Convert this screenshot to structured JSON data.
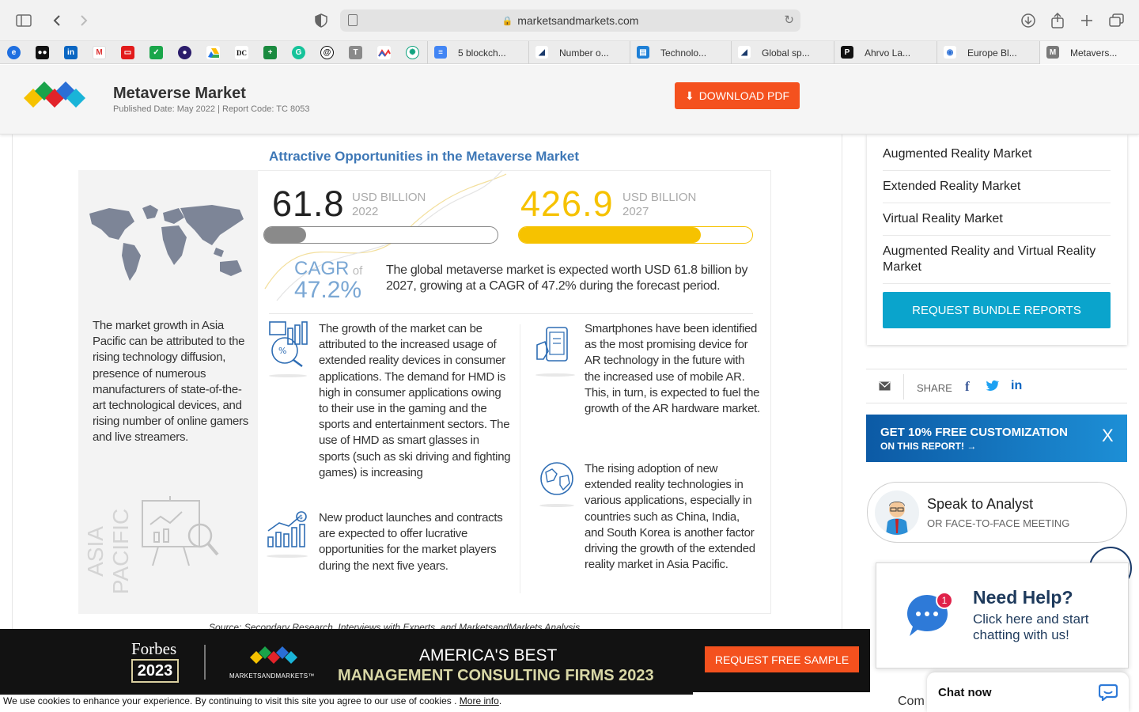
{
  "browser": {
    "url": "marketsandmarkets.com"
  },
  "bookmarks": {
    "tabs": [
      {
        "label": "5 blockch..."
      },
      {
        "label": "Number o..."
      },
      {
        "label": "Technolo..."
      },
      {
        "label": "Global sp..."
      },
      {
        "label": "Ahrvo La..."
      },
      {
        "label": "Europe Bl..."
      },
      {
        "label": "Metavers..."
      }
    ]
  },
  "header": {
    "title": "Metaverse Market",
    "subtitle": "Published Date: May 2022 | Report Code: TC 8053",
    "download_label": "DOWNLOAD PDF"
  },
  "infographic": {
    "title": "Attractive Opportunities in the Metaverse Market",
    "value_2022": "61.8",
    "unit_2022": "USD BILLION",
    "year_2022": "2022",
    "progress_2022": 0.18,
    "value_2027": "426.9",
    "unit_2027": "USD BILLION",
    "year_2027": "2027",
    "progress_2027": 0.78,
    "cagr_label": "CAGR",
    "cagr_of": "of",
    "cagr_value": "47.2%",
    "summary": "The global metaverse market is expected worth USD 61.8 billion by 2027, growing at a CAGR of 47.2% during the forecast period.",
    "asia_text": "The market growth in Asia Pacific can be attributed to the rising technology diffusion, presence of numerous manufacturers of state-of-the-art technological devices, and rising number of online gamers and live streamers.",
    "region_label": "ASIA PACIFIC",
    "point1": "The growth of the market can be attributed to the increased usage of extended reality devices in consumer applications. The demand for HMD is high in consumer applications owing to their use in the gaming and the sports and entertainment sectors. The use of HMD as smart glasses in sports (such as ski driving and fighting games) is increasing",
    "point2": "New product launches and contracts are expected to offer lucrative opportunities for the market players during the next five years.",
    "point3": "Smartphones have been identified as the most promising device for AR technology in the future with the increased use of mobile AR. This, in turn, is expected to fuel the growth of the AR hardware market.",
    "point4": "The rising adoption of new extended reality technologies in various applications, especially in countries such as China, India, and South Korea is another factor driving the growth of the extended reality market in Asia Pacific.",
    "source": "Source: Secondary Research, Interviews with Experts, and MarketsandMarkets Analysis"
  },
  "sidebar": {
    "related": [
      {
        "label": "Augmented Reality Market"
      },
      {
        "label": "Extended Reality Market"
      },
      {
        "label": "Virtual Reality Market"
      },
      {
        "label": "Augmented Reality and Virtual Reality Market"
      }
    ],
    "bundle_label": "REQUEST BUNDLE REPORTS",
    "share_label": "SHARE",
    "custom_title": "GET 10% FREE CUSTOMIZATION",
    "custom_sub": "ON THIS REPORT!",
    "custom_close": "X",
    "analyst_title": "Speak to Analyst",
    "analyst_sub": "OR FACE-TO-FACE MEETING"
  },
  "footer": {
    "forbes": "Forbes",
    "year_badge": "2023",
    "mm_brand": "MARKETSANDMARKETS™",
    "line1": "AMERICA'S BEST",
    "line2": "MANAGEMENT CONSULTING FIRMS 2023",
    "sample_label": "REQUEST FREE SAMPLE",
    "cookie_text": "We use cookies to enhance your experience. By continuing to visit this site you agree to our use of cookies .",
    "cookie_link": "More info",
    "cookie_end": "."
  },
  "chat": {
    "badge": "1",
    "help_title": "Need Help?",
    "help_sub": "Click here and start chatting with us!",
    "chat_now": "Chat now",
    "partial": "Com"
  },
  "colors": {
    "accent_orange": "#f4511e",
    "accent_blue": "#3d77b6",
    "bundle_cyan": "#0aa4cc",
    "gold": "#f6c200"
  }
}
